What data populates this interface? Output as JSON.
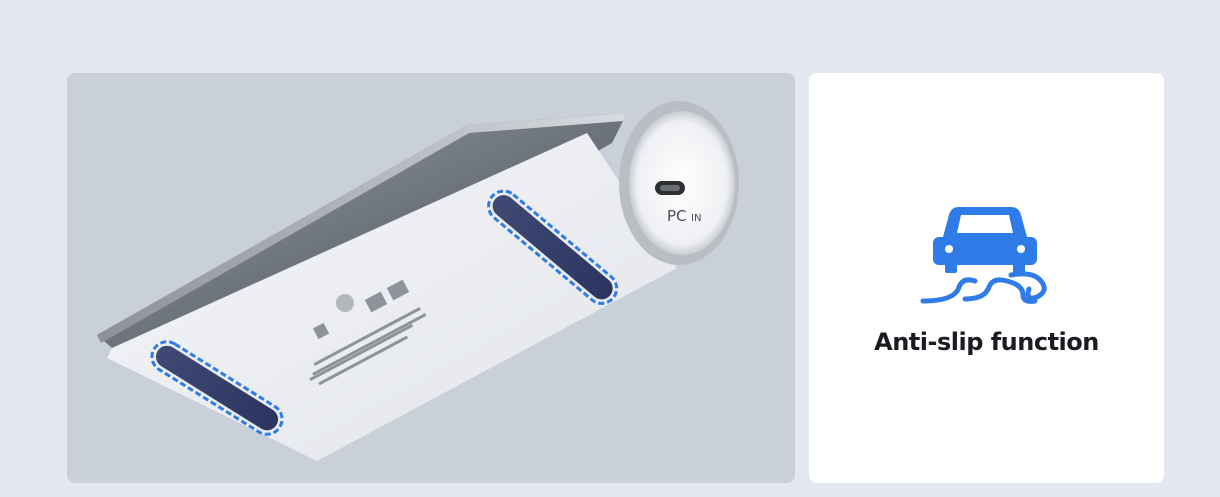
{
  "photo": {
    "port_label_main": "PC",
    "port_label_sub": "IN"
  },
  "feature": {
    "icon": "car-skid-icon",
    "label": "Anti-slip function",
    "icon_color": "#2f7ce8"
  },
  "colors": {
    "page_background": "#e3e8f0",
    "photo_background": "#c9d0da",
    "card_background": "#ffffff",
    "accent_blue": "#2f7ce8"
  }
}
